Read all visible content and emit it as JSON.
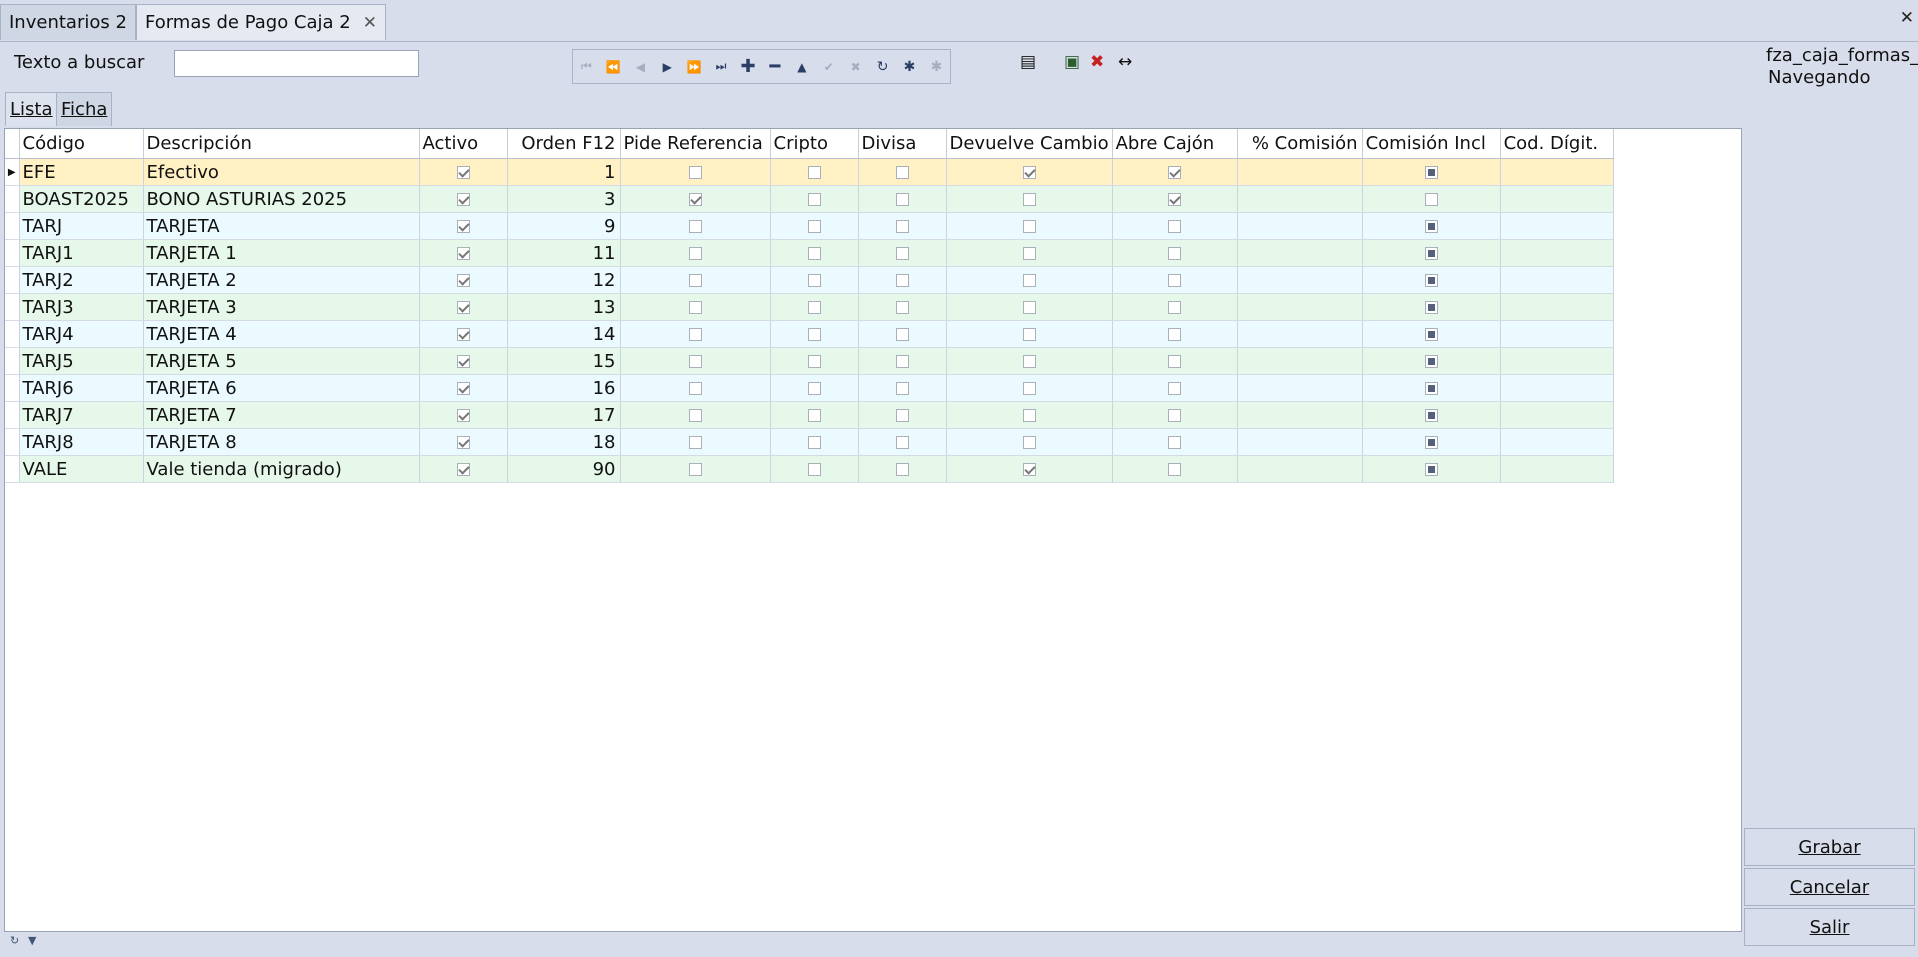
{
  "tabs": [
    {
      "label": "Inventarios 2",
      "active": false
    },
    {
      "label": "Formas de Pago Caja 2",
      "active": true
    }
  ],
  "window_close_glyph": "✕",
  "search": {
    "label": "Texto a buscar",
    "value": "",
    "placeholder": ""
  },
  "nav_icons": [
    "first-icon",
    "prior-page-icon",
    "prior-icon",
    "next-icon",
    "next-page-icon",
    "last-icon",
    "insert-icon",
    "delete-icon",
    "edit-icon",
    "post-icon",
    "cancel-icon",
    "refresh-icon",
    "apply-updates-icon",
    "cancel-updates-icon"
  ],
  "side": {
    "form_name": "fza_caja_formas_",
    "status": "Navegando"
  },
  "subtabs": [
    {
      "label": "Lista",
      "active": true
    },
    {
      "label": "Ficha",
      "active": false
    }
  ],
  "grid": {
    "columns": [
      "Código",
      "Descripción",
      "Activo",
      "Orden F12",
      "Pide Referencia",
      "Cripto",
      "Divisa",
      "Devuelve Cambio",
      "Abre Cajón",
      "% Comisión",
      "Comisión Incl",
      "Cod. Dígit."
    ],
    "rows": [
      {
        "codigo": "EFE",
        "descripcion": "Efectivo",
        "activo": true,
        "orden": "1",
        "pide_ref": false,
        "cripto": false,
        "divisa": false,
        "devuelve": true,
        "abre": true,
        "comision": "",
        "incl": "ind",
        "digit": ""
      },
      {
        "codigo": "BOAST2025",
        "descripcion": "BONO ASTURIAS 2025",
        "activo": true,
        "orden": "3",
        "pide_ref": true,
        "cripto": false,
        "divisa": false,
        "devuelve": false,
        "abre": true,
        "comision": "",
        "incl": "off",
        "digit": ""
      },
      {
        "codigo": "TARJ",
        "descripcion": "TARJETA",
        "activo": true,
        "orden": "9",
        "pide_ref": false,
        "cripto": false,
        "divisa": false,
        "devuelve": false,
        "abre": false,
        "comision": "",
        "incl": "ind",
        "digit": ""
      },
      {
        "codigo": "TARJ1",
        "descripcion": "TARJETA 1",
        "activo": true,
        "orden": "11",
        "pide_ref": false,
        "cripto": false,
        "divisa": false,
        "devuelve": false,
        "abre": false,
        "comision": "",
        "incl": "ind",
        "digit": ""
      },
      {
        "codigo": "TARJ2",
        "descripcion": "TARJETA 2",
        "activo": true,
        "orden": "12",
        "pide_ref": false,
        "cripto": false,
        "divisa": false,
        "devuelve": false,
        "abre": false,
        "comision": "",
        "incl": "ind",
        "digit": ""
      },
      {
        "codigo": "TARJ3",
        "descripcion": "TARJETA 3",
        "activo": true,
        "orden": "13",
        "pide_ref": false,
        "cripto": false,
        "divisa": false,
        "devuelve": false,
        "abre": false,
        "comision": "",
        "incl": "ind",
        "digit": ""
      },
      {
        "codigo": "TARJ4",
        "descripcion": "TARJETA 4",
        "activo": true,
        "orden": "14",
        "pide_ref": false,
        "cripto": false,
        "divisa": false,
        "devuelve": false,
        "abre": false,
        "comision": "",
        "incl": "ind",
        "digit": ""
      },
      {
        "codigo": "TARJ5",
        "descripcion": "TARJETA 5",
        "activo": true,
        "orden": "15",
        "pide_ref": false,
        "cripto": false,
        "divisa": false,
        "devuelve": false,
        "abre": false,
        "comision": "",
        "incl": "ind",
        "digit": ""
      },
      {
        "codigo": "TARJ6",
        "descripcion": "TARJETA 6",
        "activo": true,
        "orden": "16",
        "pide_ref": false,
        "cripto": false,
        "divisa": false,
        "devuelve": false,
        "abre": false,
        "comision": "",
        "incl": "ind",
        "digit": ""
      },
      {
        "codigo": "TARJ7",
        "descripcion": "TARJETA 7",
        "activo": true,
        "orden": "17",
        "pide_ref": false,
        "cripto": false,
        "divisa": false,
        "devuelve": false,
        "abre": false,
        "comision": "",
        "incl": "ind",
        "digit": ""
      },
      {
        "codigo": "TARJ8",
        "descripcion": "TARJETA 8",
        "activo": true,
        "orden": "18",
        "pide_ref": false,
        "cripto": false,
        "divisa": false,
        "devuelve": false,
        "abre": false,
        "comision": "",
        "incl": "ind",
        "digit": ""
      },
      {
        "codigo": "VALE",
        "descripcion": "Vale tienda (migrado)",
        "activo": true,
        "orden": "90",
        "pide_ref": false,
        "cripto": false,
        "divisa": false,
        "devuelve": true,
        "abre": false,
        "comision": "",
        "incl": "ind",
        "digit": ""
      }
    ],
    "selected_row": 0
  },
  "buttons": {
    "grabar": "Grabar",
    "cancelar": "Cancelar",
    "salir": "Salir"
  },
  "colors": {
    "row_odd": "#eafaff",
    "row_even": "#e6f8ea",
    "row_selected": "#fff1c4",
    "background": "#d7ddea"
  }
}
